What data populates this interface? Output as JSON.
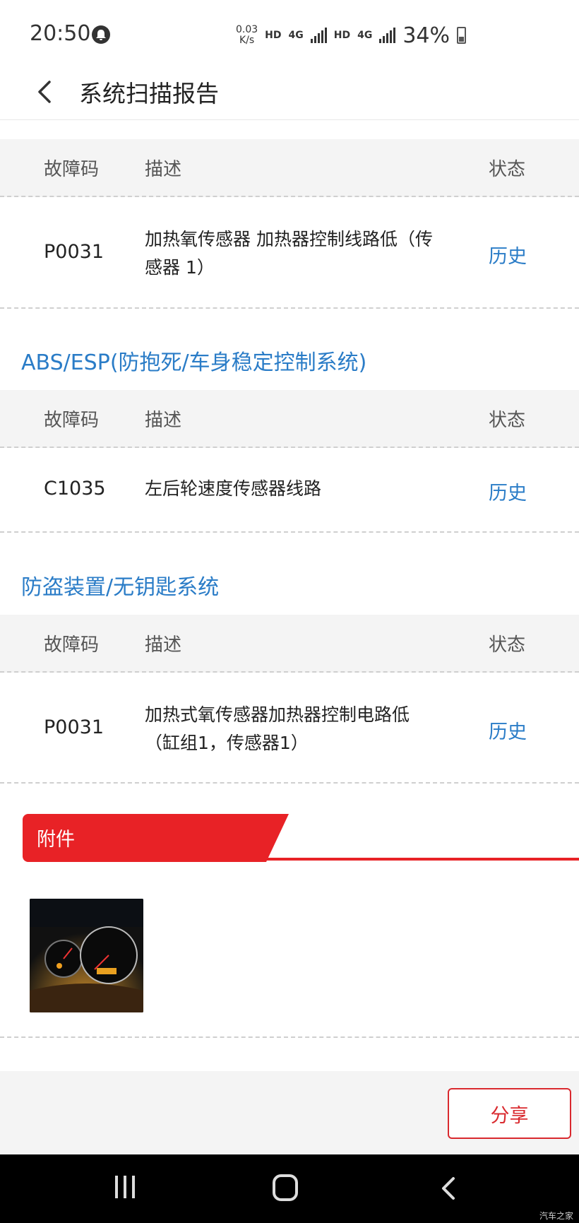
{
  "status_bar": {
    "time": "20:50",
    "net_speed_value": "0.03",
    "net_speed_unit": "K/s",
    "hd_1": "HD",
    "net_1": "4G",
    "hd_2": "HD",
    "net_2": "4G",
    "battery": "34%"
  },
  "header": {
    "title": "系统扫描报告"
  },
  "table_headers": {
    "code": "故障码",
    "desc": "描述",
    "status": "状态"
  },
  "sections": [
    {
      "title": "",
      "rows": [
        {
          "code": "P0031",
          "desc": "加热氧传感器 加热器控制线路低（传感器 1）",
          "status": "历史"
        }
      ]
    },
    {
      "title": "ABS/ESP(防抱死/车身稳定控制系统)",
      "rows": [
        {
          "code": "C1035",
          "desc": "左后轮速度传感器线路",
          "status": "历史"
        }
      ]
    },
    {
      "title": "防盗装置/无钥匙系统",
      "rows": [
        {
          "code": "P0031",
          "desc": "加热式氧传感器加热器控制电路低（缸组1，传感器1）",
          "status": "历史"
        }
      ]
    }
  ],
  "attachments": {
    "label": "附件"
  },
  "footer": {
    "share_label": "分享"
  },
  "watermark": "汽车之家",
  "colors": {
    "accent_blue": "#2a7cc7",
    "accent_red": "#e82226"
  }
}
